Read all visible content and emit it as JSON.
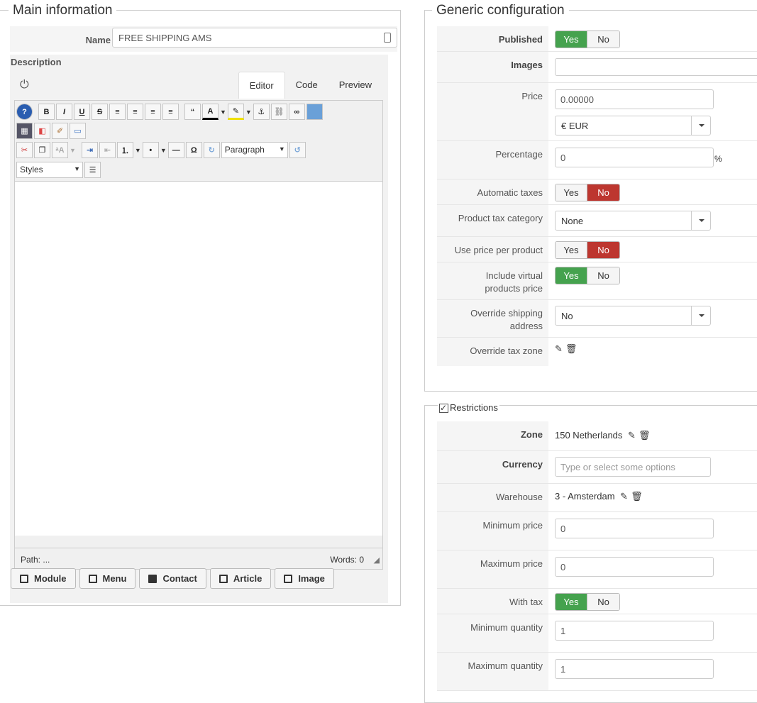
{
  "main": {
    "legend": "Main information",
    "name_label": "Name",
    "name_value": "FREE SHIPPING AMS",
    "description_label": "Description",
    "tabs": [
      "Editor",
      "Code",
      "Preview"
    ],
    "format_select": "Paragraph",
    "styles_select": "Styles",
    "status_path": "Path: ...",
    "status_words": "Words: 0",
    "buttons": [
      "Module",
      "Menu",
      "Contact",
      "Article",
      "Image"
    ]
  },
  "generic": {
    "legend": "Generic configuration",
    "published": {
      "label": "Published",
      "value": "Yes"
    },
    "images": {
      "label": "Images"
    },
    "price": {
      "label": "Price",
      "value": "0.00000",
      "currency": "€ EUR"
    },
    "percentage": {
      "label": "Percentage",
      "value": "0",
      "suffix": "%"
    },
    "automatic_taxes": {
      "label": "Automatic taxes",
      "value": "No"
    },
    "product_tax_category": {
      "label": "Product tax category",
      "value": "None"
    },
    "use_price_per_product": {
      "label": "Use price per product",
      "value": "No"
    },
    "include_virtual": {
      "label": "Include virtual products price",
      "value": "Yes"
    },
    "override_shipping": {
      "label": "Override shipping address",
      "value": "No"
    },
    "override_tax_zone": {
      "label": "Override tax zone"
    }
  },
  "toggle_labels": {
    "yes": "Yes",
    "no": "No"
  },
  "restrictions": {
    "legend": "Restrictions",
    "checked": true,
    "zone": {
      "label": "Zone",
      "value": "150 Netherlands"
    },
    "currency": {
      "label": "Currency",
      "placeholder": "Type or select some options"
    },
    "warehouse": {
      "label": "Warehouse",
      "value": "3 - Amsterdam"
    },
    "min_price": {
      "label": "Minimum price",
      "value": "0"
    },
    "max_price": {
      "label": "Maximum price",
      "value": "0"
    },
    "with_tax": {
      "label": "With tax",
      "value": "Yes"
    },
    "min_qty": {
      "label": "Minimum quantity",
      "value": "1"
    },
    "max_qty": {
      "label": "Maximum quantity",
      "value": "1"
    }
  },
  "colors": {
    "yes_on": "#45a24e",
    "no_on": "#bd362f"
  }
}
